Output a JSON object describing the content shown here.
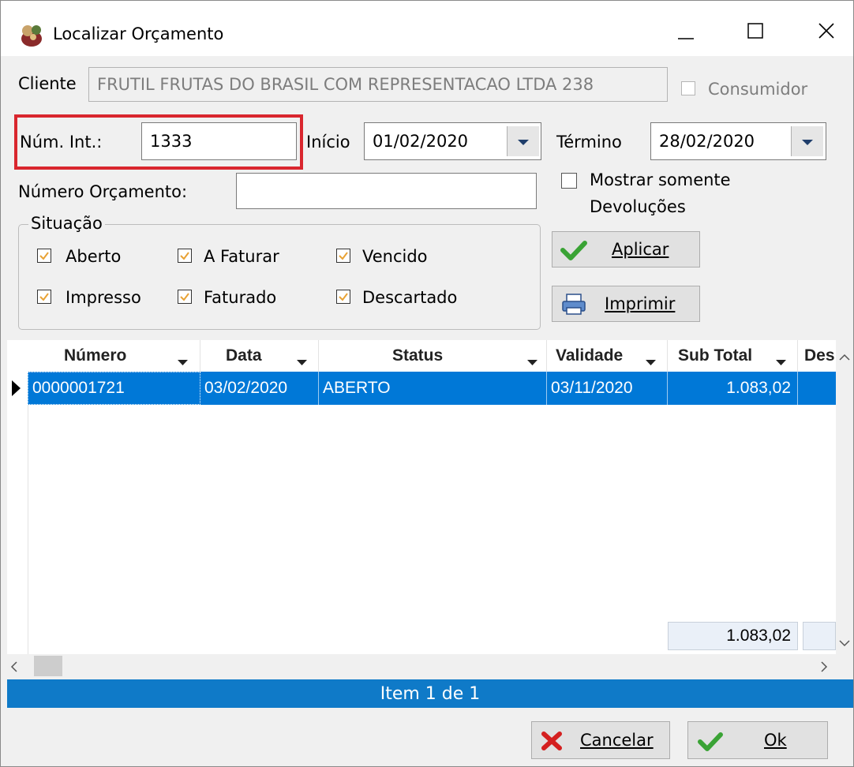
{
  "window": {
    "title": "Localizar Orçamento",
    "icons": [
      "app-icon",
      "minimize-icon",
      "maximize-icon",
      "close-icon"
    ]
  },
  "filters": {
    "cliente_label": "Cliente",
    "cliente_value": "FRUTIL FRUTAS DO BRASIL COM REPRESENTACAO LTDA 238",
    "consumidor_label": "Consumidor",
    "num_int_label": "Núm. Int.:",
    "num_int_value": "1333",
    "inicio_label": "Início",
    "inicio_value": "01/02/2020",
    "termino_label": "Término",
    "termino_value": "28/02/2020",
    "numero_orcamento_label": "Número Orçamento:",
    "numero_orcamento_value": "",
    "mostrar_line1": "Mostrar somente",
    "mostrar_line2": "Devoluções"
  },
  "situacao": {
    "legend": "Situação",
    "options": [
      {
        "label": "Aberto",
        "checked": true
      },
      {
        "label": "A Faturar",
        "checked": true
      },
      {
        "label": "Vencido",
        "checked": true
      },
      {
        "label": "Impresso",
        "checked": true
      },
      {
        "label": "Faturado",
        "checked": true
      },
      {
        "label": "Descartado",
        "checked": true
      }
    ]
  },
  "buttons": {
    "aplicar": "Aplicar",
    "imprimir": "Imprimir",
    "cancelar": "Cancelar",
    "ok": "Ok"
  },
  "grid": {
    "columns": [
      "Número",
      "Data",
      "Status",
      "Validade",
      "Sub Total",
      "Des"
    ],
    "rows": [
      {
        "numero": "0000001721",
        "data": "03/02/2020",
        "status": "ABERTO",
        "validade": "03/11/2020",
        "subtotal": "1.083,02",
        "des": ""
      }
    ],
    "footer_total": "1.083,02"
  },
  "status_bar": {
    "text": "Item 1 de 1"
  },
  "colors": {
    "selection": "#0078d7",
    "highlight_border": "#d9262e",
    "check": "#e8a235",
    "status_bar": "#0f7ac8"
  }
}
